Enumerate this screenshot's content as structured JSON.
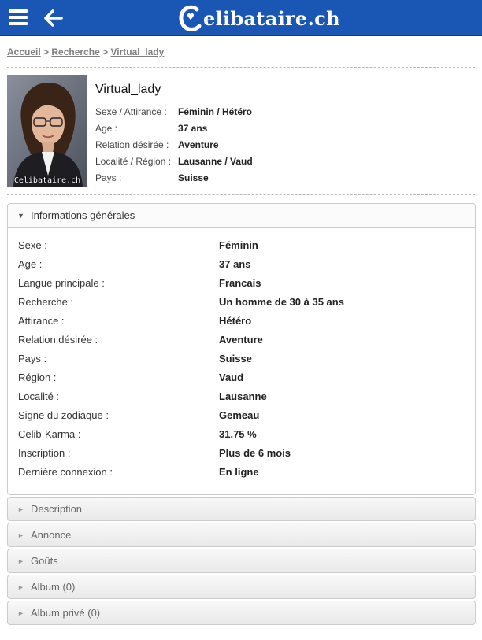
{
  "header": {
    "logo_text": "elibataire.ch",
    "bar_color": "#1a56b4",
    "menu_icon": "hamburger-icon",
    "back_icon": "arrow-left-icon"
  },
  "breadcrumb": {
    "items": [
      "Accueil",
      "Recherche",
      "Virtual_lady"
    ],
    "separator": ">"
  },
  "profile": {
    "photo_caption": "Celibataire.ch",
    "username": "Virtual_lady",
    "summary": [
      {
        "label": "Sexe / Attirance :",
        "value": "Féminin / Hétéro"
      },
      {
        "label": "Age :",
        "value": "37 ans"
      },
      {
        "label": "Relation désirée :",
        "value": "Aventure"
      },
      {
        "label": "Localité / Région :",
        "value": "Lausanne / Vaud"
      },
      {
        "label": "Pays :",
        "value": "Suisse"
      }
    ]
  },
  "info_panel": {
    "title": "Informations générales",
    "expanded": true,
    "rows": [
      {
        "label": "Sexe :",
        "value": "Féminin"
      },
      {
        "label": "Age :",
        "value": "37 ans"
      },
      {
        "label": "Langue principale :",
        "value": "Francais"
      },
      {
        "label": "Recherche :",
        "value": "Un homme de 30 à 35 ans"
      },
      {
        "label": "Attirance :",
        "value": "Hétéro"
      },
      {
        "label": "Relation désirée :",
        "value": "Aventure"
      },
      {
        "label": "Pays :",
        "value": "Suisse"
      },
      {
        "label": "Région :",
        "value": "Vaud"
      },
      {
        "label": "Localité :",
        "value": "Lausanne"
      },
      {
        "label": "Signe du zodiaque :",
        "value": "Gemeau"
      },
      {
        "label": "Celib-Karma :",
        "value": "31.75 %"
      },
      {
        "label": "Inscription :",
        "value": "Plus de 6 mois"
      },
      {
        "label": "Dernière connexion :",
        "value": "En ligne"
      }
    ]
  },
  "collapsed_panels": [
    {
      "title": "Description"
    },
    {
      "title": "Annonce"
    },
    {
      "title": "Goûts"
    },
    {
      "title": "Album (0)"
    },
    {
      "title": "Album privé (0)"
    }
  ]
}
